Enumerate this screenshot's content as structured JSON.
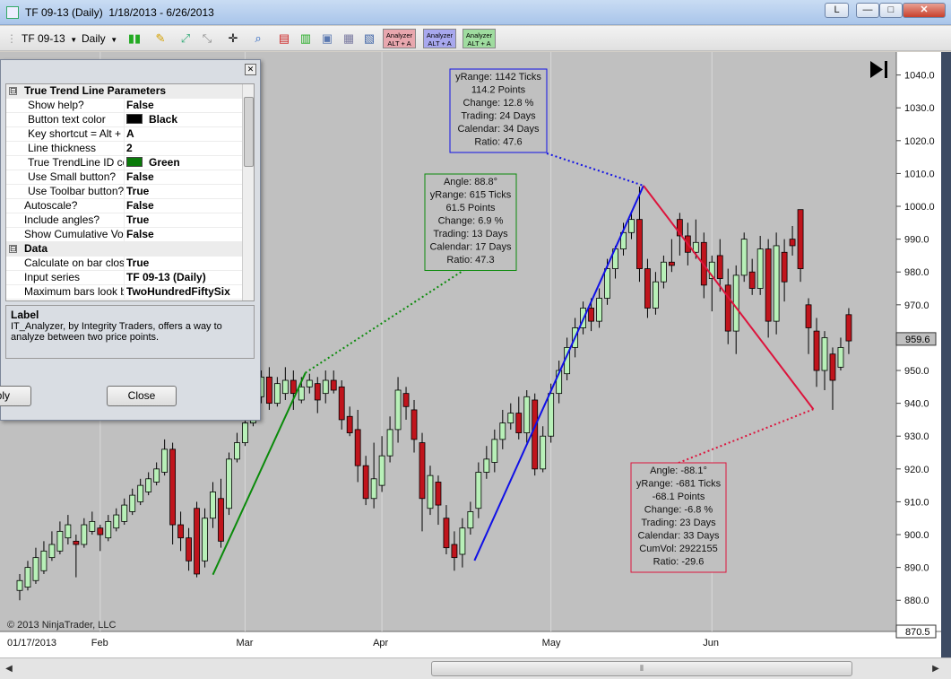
{
  "window": {
    "title": "TF 09-13 (Daily)  1/18/2013 - 6/26/2013",
    "buttons": {
      "layout": "L",
      "minimize": "—",
      "maximize": "□",
      "close": "✕"
    }
  },
  "toolbar": {
    "instrument": "TF 09-13",
    "interval": "Daily",
    "analyzer_buttons": [
      {
        "line1": "Analyzer",
        "line2": "ALT + A",
        "color": "#e8a7ae"
      },
      {
        "line1": "Analyzer",
        "line2": "ALT + A",
        "color": "#a8a8ee"
      },
      {
        "line1": "Analyzer",
        "line2": "ALT + A",
        "color": "#9fdc9f"
      }
    ]
  },
  "dialog": {
    "sections": [
      {
        "title": "True Trend Line Parameters",
        "expand": "⊟"
      },
      {
        "title": "Data",
        "expand": "⊟"
      }
    ],
    "params": [
      {
        "label": "Show help?",
        "value": "False",
        "indent": true
      },
      {
        "label": "Button text color",
        "value": "Black",
        "indent": true,
        "swatch": "#000000"
      },
      {
        "label": "Key shortcut = Alt +",
        "value": "A",
        "indent": true
      },
      {
        "label": "Line thickness",
        "value": "2",
        "indent": true
      },
      {
        "label": "True TrendLine ID color",
        "value": "Green",
        "indent": true,
        "swatch": "#0a7a0a"
      },
      {
        "label": "Use Small button?",
        "value": "False",
        "indent": true
      },
      {
        "label": "Use Toolbar button?",
        "value": "True",
        "indent": true
      },
      {
        "label": "Autoscale?",
        "value": "False",
        "indent": false
      },
      {
        "label": "Include angles?",
        "value": "True",
        "indent": false
      },
      {
        "label": "Show Cumulative Vol.",
        "value": "False",
        "indent": false
      }
    ],
    "data_params": [
      {
        "label": "Calculate on bar close",
        "value": "True"
      },
      {
        "label": "Input series",
        "value": "TF 09-13 (Daily)"
      },
      {
        "label": "Maximum bars look back",
        "value": "TwoHundredFiftySix"
      }
    ],
    "help_title": "Label",
    "help_text": "IT_Analyzer, by Integrity Traders, offers a way to analyze between two price points.",
    "apply_label": "Apply",
    "close_label": "Close"
  },
  "chart_data": {
    "type": "candlestick",
    "instrument": "TF 09-13 (Daily)",
    "copyright": "© 2013 NinjaTrader, LLC",
    "y_ticks": [
      "1040.0",
      "1030.0",
      "1020.0",
      "1010.0",
      "1000.0",
      "990.0",
      "980.0",
      "970.0",
      "960.0",
      "950.0",
      "940.0",
      "930.0",
      "920.0",
      "910.0",
      "900.0",
      "890.0",
      "880.0"
    ],
    "ylim": [
      870.5,
      1047
    ],
    "x_labels": [
      "01/17/2013",
      "Feb",
      "Mar",
      "Apr",
      "May",
      "Jun"
    ],
    "last_price": "959.6",
    "min_price": "870.5",
    "candles": [
      [
        883,
        886,
        880,
        888
      ],
      [
        884,
        890,
        883,
        892
      ],
      [
        886,
        893,
        885,
        896
      ],
      [
        889,
        895,
        888,
        898
      ],
      [
        893,
        897,
        892,
        901
      ],
      [
        895,
        901,
        894,
        904
      ],
      [
        899,
        903,
        897,
        906
      ],
      [
        898,
        897,
        887,
        900
      ],
      [
        897,
        903,
        896,
        905
      ],
      [
        901,
        904,
        900,
        907
      ],
      [
        902,
        900,
        895,
        903
      ],
      [
        899,
        904,
        898,
        906
      ],
      [
        902,
        906,
        901,
        908
      ],
      [
        904,
        909,
        903,
        911
      ],
      [
        907,
        912,
        906,
        914
      ],
      [
        910,
        915,
        909,
        917
      ],
      [
        913,
        917,
        912,
        919
      ],
      [
        916,
        920,
        915,
        922
      ],
      [
        919,
        926,
        918,
        929
      ],
      [
        926,
        903,
        897,
        928
      ],
      [
        903,
        899,
        895,
        907
      ],
      [
        899,
        892,
        889,
        902
      ],
      [
        908,
        888,
        887,
        910
      ],
      [
        892,
        905,
        890,
        908
      ],
      [
        905,
        913,
        902,
        916
      ],
      [
        911,
        898,
        896,
        917
      ],
      [
        908,
        923,
        906,
        925
      ],
      [
        923,
        928,
        922,
        931
      ],
      [
        928,
        934,
        927,
        936
      ],
      [
        934,
        943,
        933,
        946
      ],
      [
        942,
        948,
        940,
        950
      ],
      [
        948,
        940,
        938,
        951
      ],
      [
        940,
        946,
        939,
        948
      ],
      [
        943,
        947,
        941,
        951
      ],
      [
        947,
        943,
        938,
        950
      ],
      [
        941,
        945,
        940,
        948
      ],
      [
        945,
        947,
        943,
        949
      ],
      [
        946,
        941,
        937,
        948
      ],
      [
        943,
        947,
        940,
        950
      ],
      [
        947,
        944,
        943,
        950
      ],
      [
        945,
        935,
        932,
        947
      ],
      [
        936,
        931,
        930,
        939
      ],
      [
        932,
        921,
        916,
        938
      ],
      [
        921,
        911,
        909,
        924
      ],
      [
        911,
        917,
        908,
        928
      ],
      [
        915,
        924,
        913,
        930
      ],
      [
        924,
        932,
        922,
        936
      ],
      [
        932,
        944,
        928,
        948
      ],
      [
        943,
        939,
        935,
        945
      ],
      [
        938,
        929,
        925,
        941
      ],
      [
        928,
        911,
        901,
        931
      ],
      [
        908,
        918,
        906,
        921
      ],
      [
        916,
        909,
        903,
        918
      ],
      [
        905,
        896,
        894,
        909
      ],
      [
        897,
        893,
        889,
        901
      ],
      [
        894,
        902,
        890,
        905
      ],
      [
        902,
        907,
        900,
        910
      ],
      [
        908,
        919,
        905,
        922
      ],
      [
        919,
        923,
        917,
        927
      ],
      [
        922,
        929,
        919,
        932
      ],
      [
        929,
        934,
        926,
        938
      ],
      [
        934,
        937,
        932,
        940
      ],
      [
        937,
        931,
        929,
        942
      ],
      [
        931,
        942,
        928,
        944
      ],
      [
        941,
        920,
        918,
        943
      ],
      [
        920,
        930,
        919,
        933
      ],
      [
        930,
        943,
        928,
        946
      ],
      [
        943,
        950,
        940,
        953
      ],
      [
        949,
        957,
        947,
        960
      ],
      [
        957,
        963,
        954,
        966
      ],
      [
        963,
        969,
        961,
        971
      ],
      [
        969,
        965,
        962,
        972
      ],
      [
        965,
        972,
        963,
        975
      ],
      [
        972,
        981,
        970,
        984
      ],
      [
        981,
        987,
        978,
        988
      ],
      [
        987,
        992,
        985,
        995
      ],
      [
        992,
        996,
        990,
        998
      ],
      [
        996,
        981,
        977,
        1006
      ],
      [
        981,
        969,
        966,
        984
      ],
      [
        969,
        977,
        967,
        980
      ],
      [
        977,
        983,
        975,
        985
      ],
      [
        983,
        982,
        980,
        990
      ],
      [
        996,
        991,
        985,
        998
      ],
      [
        991,
        986,
        982,
        995
      ],
      [
        986,
        989,
        984,
        996
      ],
      [
        989,
        976,
        972,
        992
      ],
      [
        978,
        983,
        968,
        985
      ],
      [
        985,
        978,
        974,
        990
      ],
      [
        976,
        962,
        958,
        981
      ],
      [
        962,
        979,
        955,
        982
      ],
      [
        979,
        990,
        977,
        992
      ],
      [
        980,
        975,
        973,
        984
      ],
      [
        975,
        987,
        973,
        991
      ],
      [
        987,
        965,
        960,
        990
      ],
      [
        965,
        988,
        961,
        992
      ],
      [
        986,
        977,
        971,
        990
      ],
      [
        990,
        988,
        985,
        994
      ],
      [
        999,
        981,
        977,
        999
      ],
      [
        970,
        963,
        955,
        972
      ],
      [
        962,
        950,
        945,
        966
      ],
      [
        950,
        960,
        944,
        962
      ],
      [
        955,
        947,
        938,
        957
      ],
      [
        951,
        957,
        950,
        960
      ],
      [
        967,
        959,
        955,
        969
      ]
    ],
    "trend_lines": [
      {
        "color": "#0a8a0a",
        "from": "2013-02-25",
        "from_price": 887.8,
        "to": "2013-03-15",
        "to_price": 949.3
      },
      {
        "color": "#1010e6",
        "from": "2013-04-18",
        "from_price": 892.1,
        "to": "2013-05-21",
        "to_price": 1006.3
      },
      {
        "color": "#dc143c",
        "from": "2013-05-21",
        "from_price": 1006.3,
        "to": "2013-06-24",
        "to_price": 938.2
      }
    ],
    "annotations": {
      "blue": [
        "yRange: 1142 Ticks",
        "114.2 Points",
        "Change: 12.8 %",
        "Trading: 24 Days",
        "Calendar: 34 Days",
        "Ratio: 47.6"
      ],
      "green": [
        "Angle: 88.8°",
        "yRange: 615 Ticks",
        "61.5 Points",
        "Change: 6.9 %",
        "Trading: 13 Days",
        "Calendar: 17 Days",
        "Ratio: 47.3"
      ],
      "red": [
        "Angle: -88.1°",
        "yRange: -681 Ticks",
        "-68.1 Points",
        "Change: -6.8 %",
        "Trading: 23 Days",
        "Calendar: 33 Days",
        "CumVol: 2922155",
        "Ratio: -29.6"
      ]
    }
  }
}
